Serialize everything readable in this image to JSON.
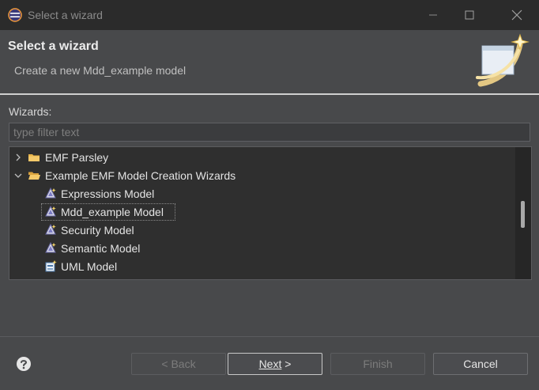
{
  "window": {
    "title": "Select a wizard"
  },
  "banner": {
    "title": "Select a wizard",
    "subtitle": "Create a new Mdd_example model"
  },
  "wizards_label": "Wizards:",
  "filter": {
    "placeholder": "type filter text",
    "value": ""
  },
  "tree": {
    "items": [
      {
        "label": "EMF Parsley",
        "icon": "folder-icon",
        "expanded": false
      },
      {
        "label": "Example EMF Model Creation Wizards",
        "icon": "folder-open-icon",
        "expanded": true
      },
      {
        "label": "Expressions Model",
        "icon": "model-wizard-icon"
      },
      {
        "label": "Mdd_example Model",
        "icon": "model-wizard-icon",
        "selected": true
      },
      {
        "label": "Security Model",
        "icon": "model-wizard-icon"
      },
      {
        "label": "Semantic Model",
        "icon": "model-wizard-icon"
      },
      {
        "label": "UML Model",
        "icon": "uml-model-icon"
      }
    ]
  },
  "buttons": {
    "back_prefix": "< ",
    "back_label": "Back",
    "next_label": "Next",
    "next_suffix": " >",
    "finish_label": "Finish",
    "cancel_label": "Cancel"
  },
  "colors": {
    "background": "#48494b",
    "titlebar": "#2b2b2b",
    "tree_background": "#2f2f2f",
    "folder": "#e8b54a"
  }
}
